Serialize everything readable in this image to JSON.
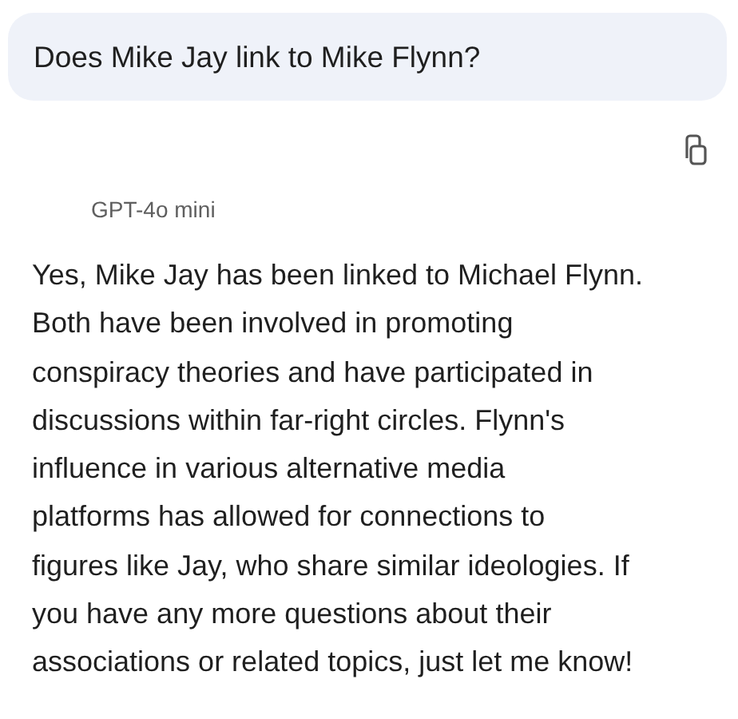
{
  "question": "Does Mike Jay link to Mike Flynn?",
  "model": "GPT-4o mini",
  "answer_lines": [
    "Yes, Mike Jay has been linked to Michael Flynn.",
    "Both have been involved in promoting",
    "conspiracy theories and have participated in",
    "discussions within far-right circles. Flynn's",
    "influence in various alternative media",
    "platforms has allowed for connections to",
    "figures like Jay, who share similar ideologies. If",
    "you have any more questions about their",
    "associations or related topics, just let me know!"
  ]
}
